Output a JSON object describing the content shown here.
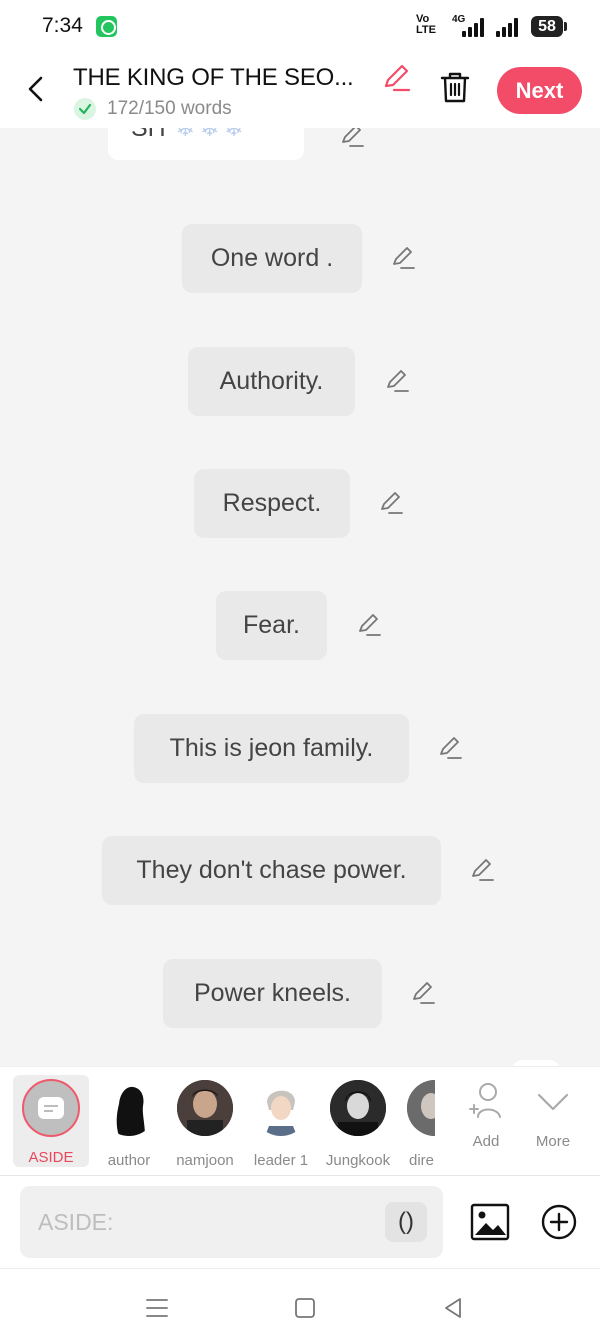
{
  "status_bar": {
    "time": "7:34",
    "network_volte": "Vo LTE",
    "network_type": "4G",
    "battery": "58"
  },
  "header": {
    "title": "THE KING OF THE SEO...",
    "word_count": "172/150 words",
    "next_label": "Next",
    "accent_color": "#f24c68"
  },
  "chat": {
    "top_partial": {
      "text": "SH",
      "emoji": "❄❄❄"
    },
    "messages": [
      {
        "text": "One word ."
      },
      {
        "text": "Authority."
      },
      {
        "text": "Respect."
      },
      {
        "text": "Fear."
      },
      {
        "text": "This is jeon family."
      },
      {
        "text": "They don't chase power."
      },
      {
        "text": "Power kneels."
      }
    ]
  },
  "characters": [
    {
      "name": "ASIDE",
      "selected": true,
      "icon": "aside-icon"
    },
    {
      "name": "author",
      "selected": false,
      "icon": "silhouette-avatar"
    },
    {
      "name": "namjoon",
      "selected": false,
      "icon": "photo-avatar"
    },
    {
      "name": "leader 1",
      "selected": false,
      "icon": "anime-avatar"
    },
    {
      "name": "Jungkook",
      "selected": false,
      "icon": "photo-avatar"
    },
    {
      "name": "dire",
      "selected": false,
      "icon": "photo-avatar"
    }
  ],
  "actions": {
    "add_label": "Add",
    "more_label": "More"
  },
  "composer": {
    "placeholder": "ASIDE:",
    "paren_label": "()"
  }
}
